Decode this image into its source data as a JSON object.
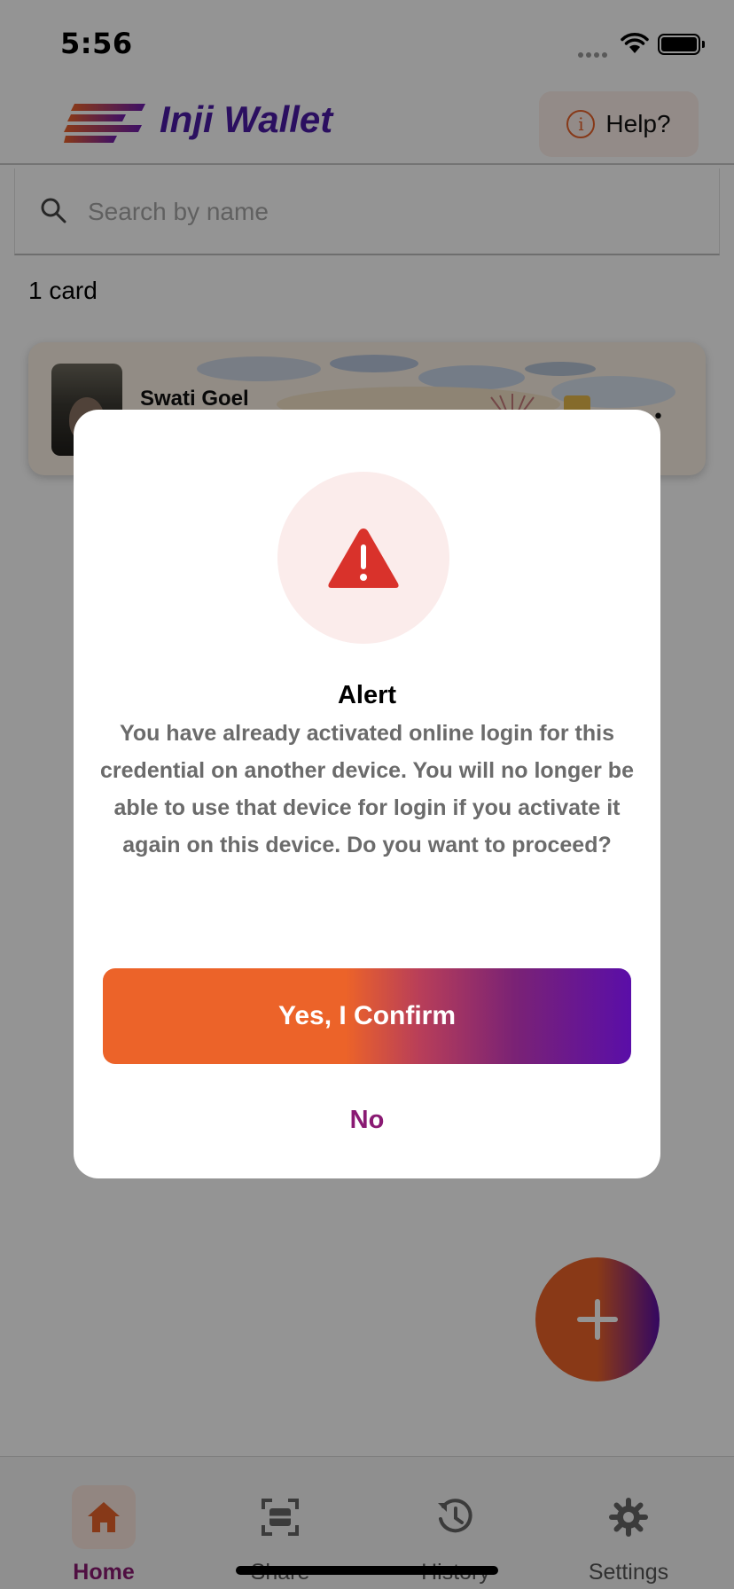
{
  "status_bar": {
    "time": "5:56"
  },
  "header": {
    "app_name": "Inji Wallet",
    "help_label": "Help?",
    "help_icon": "info-icon"
  },
  "search": {
    "placeholder": "Search by name",
    "value": ""
  },
  "wallet": {
    "card_count": "1 card",
    "cards": [
      {
        "name": "Swati Goel",
        "menu_label": "•••"
      }
    ]
  },
  "fab": {
    "icon": "plus-icon"
  },
  "tabs": [
    {
      "label": "Home",
      "icon": "home-icon",
      "active": true
    },
    {
      "label": "Share",
      "icon": "scan-icon",
      "active": false
    },
    {
      "label": "History",
      "icon": "history-icon",
      "active": false
    },
    {
      "label": "Settings",
      "icon": "gear-icon",
      "active": false
    }
  ],
  "dialog": {
    "icon": "warning-icon",
    "title": "Alert",
    "message": "You have already activated online login for this credential on another device. You will no longer be able to use that device for login if you activate it again on this device. Do you want to proceed?",
    "confirm_label": "Yes, I Confirm",
    "cancel_label": "No"
  },
  "colors": {
    "brand_orange": "#ec6329",
    "brand_purple": "#5a0ea8",
    "accent_magenta": "#8a1a73",
    "alert_red": "#d9322b"
  }
}
